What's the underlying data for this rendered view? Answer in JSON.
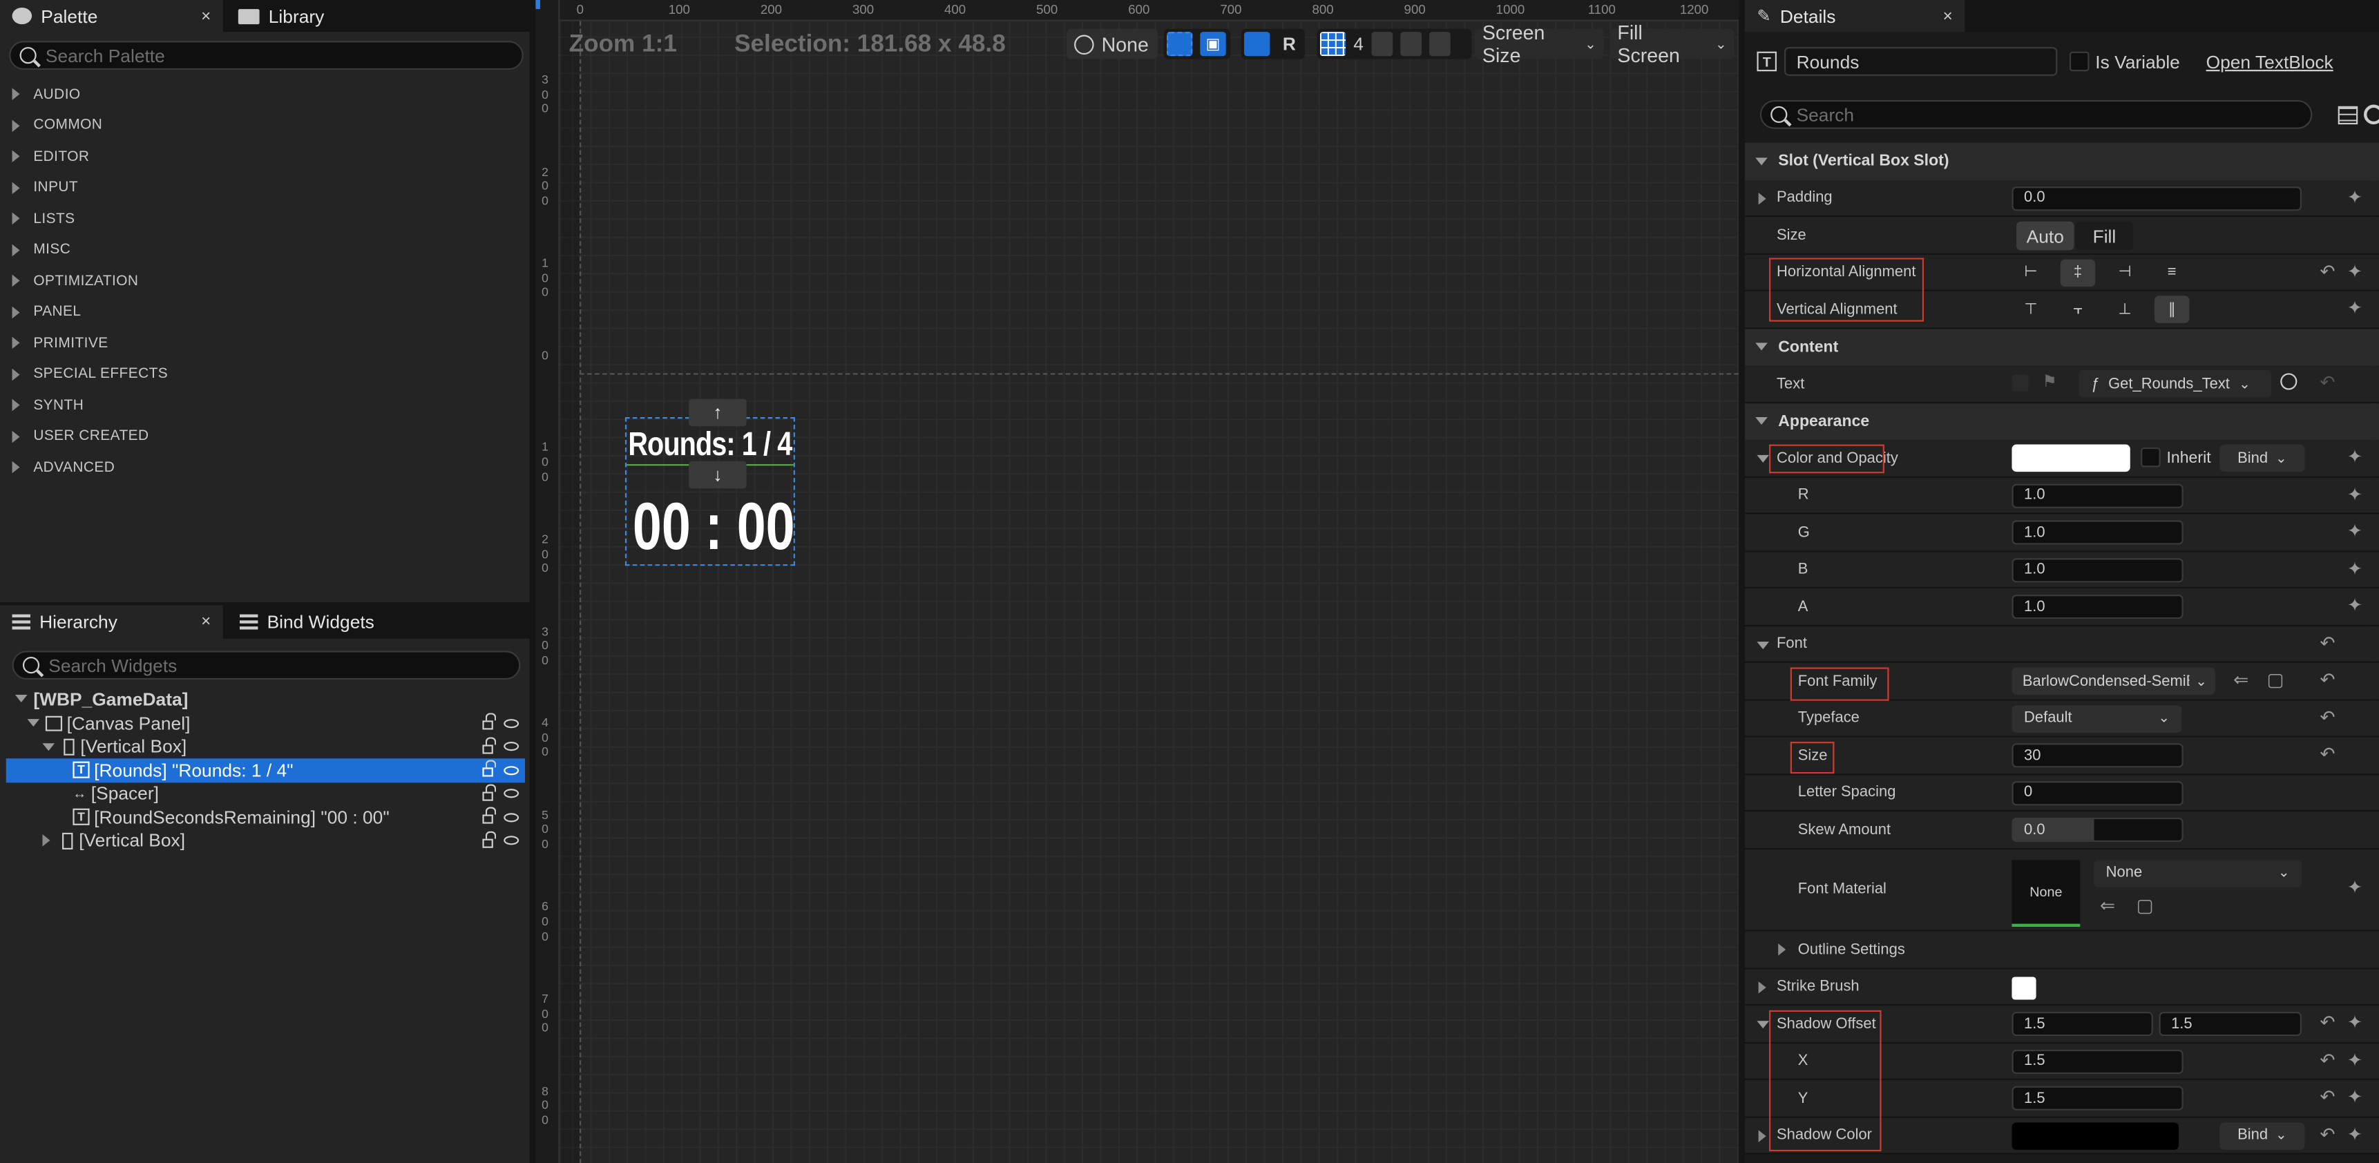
{
  "palette": {
    "tab_label": "Palette",
    "library_tab_label": "Library",
    "close": "×",
    "search_placeholder": "Search Palette",
    "categories": [
      "AUDIO",
      "COMMON",
      "EDITOR",
      "INPUT",
      "LISTS",
      "MISC",
      "OPTIMIZATION",
      "PANEL",
      "PRIMITIVE",
      "SPECIAL EFFECTS",
      "SYNTH",
      "USER CREATED",
      "ADVANCED"
    ]
  },
  "hierarchy": {
    "tab_label": "Hierarchy",
    "bind_tab_label": "Bind Widgets",
    "close": "×",
    "search_placeholder": "Search Widgets",
    "items": [
      {
        "label": "[WBP_GameData]"
      },
      {
        "label": "[Canvas Panel]"
      },
      {
        "label": "[Vertical Box]"
      },
      {
        "label": "[Rounds] \"Rounds: 1 / 4\""
      },
      {
        "label": "[Spacer]"
      },
      {
        "label": "[RoundSecondsRemaining] \"00 : 00\""
      },
      {
        "label": "[Vertical Box]"
      }
    ]
  },
  "viewport": {
    "zoom": "Zoom 1:1",
    "selection": "Selection: 181.68 x 48.8",
    "none_label": "None",
    "r_label": "R",
    "grid_count": "4",
    "screen_size": "Screen Size",
    "fill_screen": "Fill Screen",
    "ruler_top": [
      "0",
      "100",
      "200",
      "300",
      "400",
      "500",
      "600",
      "700",
      "800",
      "900",
      "1000",
      "1100",
      "1200"
    ],
    "ruler_left": [
      "300",
      "200",
      "100",
      "0",
      "100",
      "200",
      "300",
      "400",
      "500",
      "600",
      "700",
      "800"
    ],
    "widget_rounds_text": "Rounds: 1 / 4",
    "widget_timer_text": "00 : 00"
  },
  "details": {
    "tab_label": "Details",
    "close": "×",
    "name_value": "Rounds",
    "is_variable_label": "Is Variable",
    "open_textblock": "Open TextBlock",
    "search_placeholder": "Search",
    "slot_section": "Slot (Vertical Box Slot)",
    "padding_label": "Padding",
    "padding_value": "0.0",
    "size_label": "Size",
    "size_auto": "Auto",
    "size_fill": "Fill",
    "halign_label": "Horizontal Alignment",
    "valign_label": "Vertical Alignment",
    "content_section": "Content",
    "text_label": "Text",
    "text_binding": "Get_Rounds_Text",
    "appearance_section": "Appearance",
    "color_label": "Color and Opacity",
    "color_swatch": "#ffffff",
    "inherit_label": "Inherit",
    "bind_label": "Bind",
    "r_label": "R",
    "r_value": "1.0",
    "g_label": "G",
    "g_value": "1.0",
    "b_label": "B",
    "b_value": "1.0",
    "a_label": "A",
    "a_value": "1.0",
    "font_label": "Font",
    "font_family_label": "Font Family",
    "font_family_value": "BarlowCondensed-SemiB",
    "typeface_label": "Typeface",
    "typeface_value": "Default",
    "font_size_label": "Size",
    "font_size_value": "30",
    "letter_spacing_label": "Letter Spacing",
    "letter_spacing_value": "0",
    "skew_label": "Skew Amount",
    "skew_value": "0.0",
    "font_material_label": "Font Material",
    "font_material_thumb": "None",
    "font_material_value": "None",
    "outline_label": "Outline Settings",
    "strike_label": "Strike Brush",
    "shadow_offset_label": "Shadow Offset",
    "shadow_offset_x_value": "1.5",
    "shadow_offset_y_value": "1.5",
    "x_label": "X",
    "x_value": "1.5",
    "y_label": "Y",
    "y_value": "1.5",
    "shadow_color_label": "Shadow Color",
    "shadow_color_swatch": "#000000",
    "shadow_bind_label": "Bind"
  },
  "colors": {
    "accent": "#1d6fd6",
    "highlight_box": "#d23a2e"
  }
}
